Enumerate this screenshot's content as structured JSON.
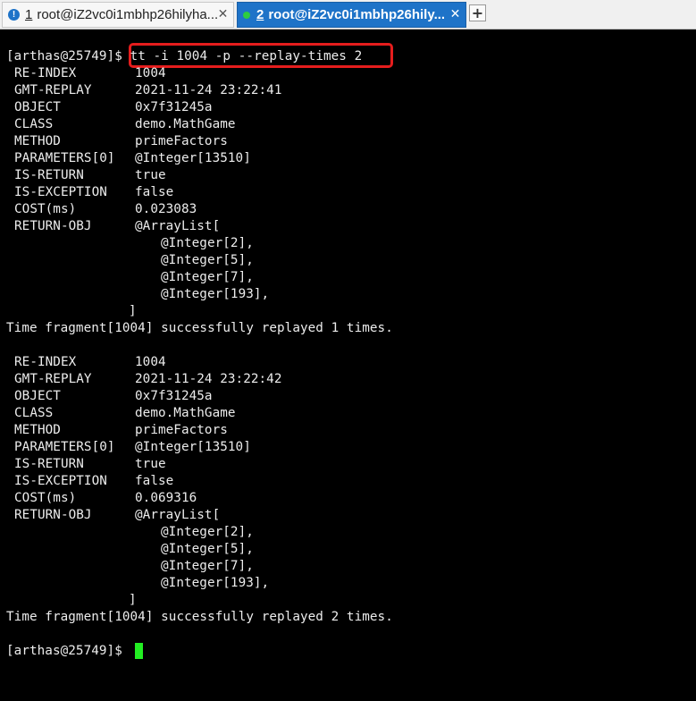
{
  "tabs": [
    {
      "number": "1",
      "title": "root@iZ2vc0i1mbhp26hilyha..."
    },
    {
      "number": "2",
      "title": "root@iZ2vc0i1mbhp26hily..."
    }
  ],
  "terminal": {
    "prompt": "[arthas@25749]$",
    "command": "tt -i 1004 -p --replay-times 2",
    "replays": [
      {
        "fields": [
          {
            "key": "RE-INDEX",
            "value": "1004"
          },
          {
            "key": "GMT-REPLAY",
            "value": "2021-11-24 23:22:41"
          },
          {
            "key": "OBJECT",
            "value": "0x7f31245a"
          },
          {
            "key": "CLASS",
            "value": "demo.MathGame"
          },
          {
            "key": "METHOD",
            "value": "primeFactors"
          },
          {
            "key": "PARAMETERS[0]",
            "value": "@Integer[13510]"
          },
          {
            "key": "IS-RETURN",
            "value": "true"
          },
          {
            "key": "IS-EXCEPTION",
            "value": "false"
          },
          {
            "key": "COST(ms)",
            "value": "0.023083"
          },
          {
            "key": "RETURN-OBJ",
            "value": "@ArrayList["
          }
        ],
        "items": [
          "@Integer[2],",
          "@Integer[5],",
          "@Integer[7],",
          "@Integer[193],"
        ],
        "close": "]",
        "message": "Time fragment[1004] successfully replayed 1 times."
      },
      {
        "fields": [
          {
            "key": "RE-INDEX",
            "value": "1004"
          },
          {
            "key": "GMT-REPLAY",
            "value": "2021-11-24 23:22:42"
          },
          {
            "key": "OBJECT",
            "value": "0x7f31245a"
          },
          {
            "key": "CLASS",
            "value": "demo.MathGame"
          },
          {
            "key": "METHOD",
            "value": "primeFactors"
          },
          {
            "key": "PARAMETERS[0]",
            "value": "@Integer[13510]"
          },
          {
            "key": "IS-RETURN",
            "value": "true"
          },
          {
            "key": "IS-EXCEPTION",
            "value": "false"
          },
          {
            "key": "COST(ms)",
            "value": "0.069316"
          },
          {
            "key": "RETURN-OBJ",
            "value": "@ArrayList["
          }
        ],
        "items": [
          "@Integer[2],",
          "@Integer[5],",
          "@Integer[7],",
          "@Integer[193],"
        ],
        "close": "]",
        "message": "Time fragment[1004] successfully replayed 2 times."
      }
    ]
  },
  "colors": {
    "terminal_bg": "#000000",
    "terminal_text": "#ececec",
    "active_tab": "#1e73c8",
    "highlight_border": "#e51d1d",
    "cursor": "#22ee22"
  }
}
